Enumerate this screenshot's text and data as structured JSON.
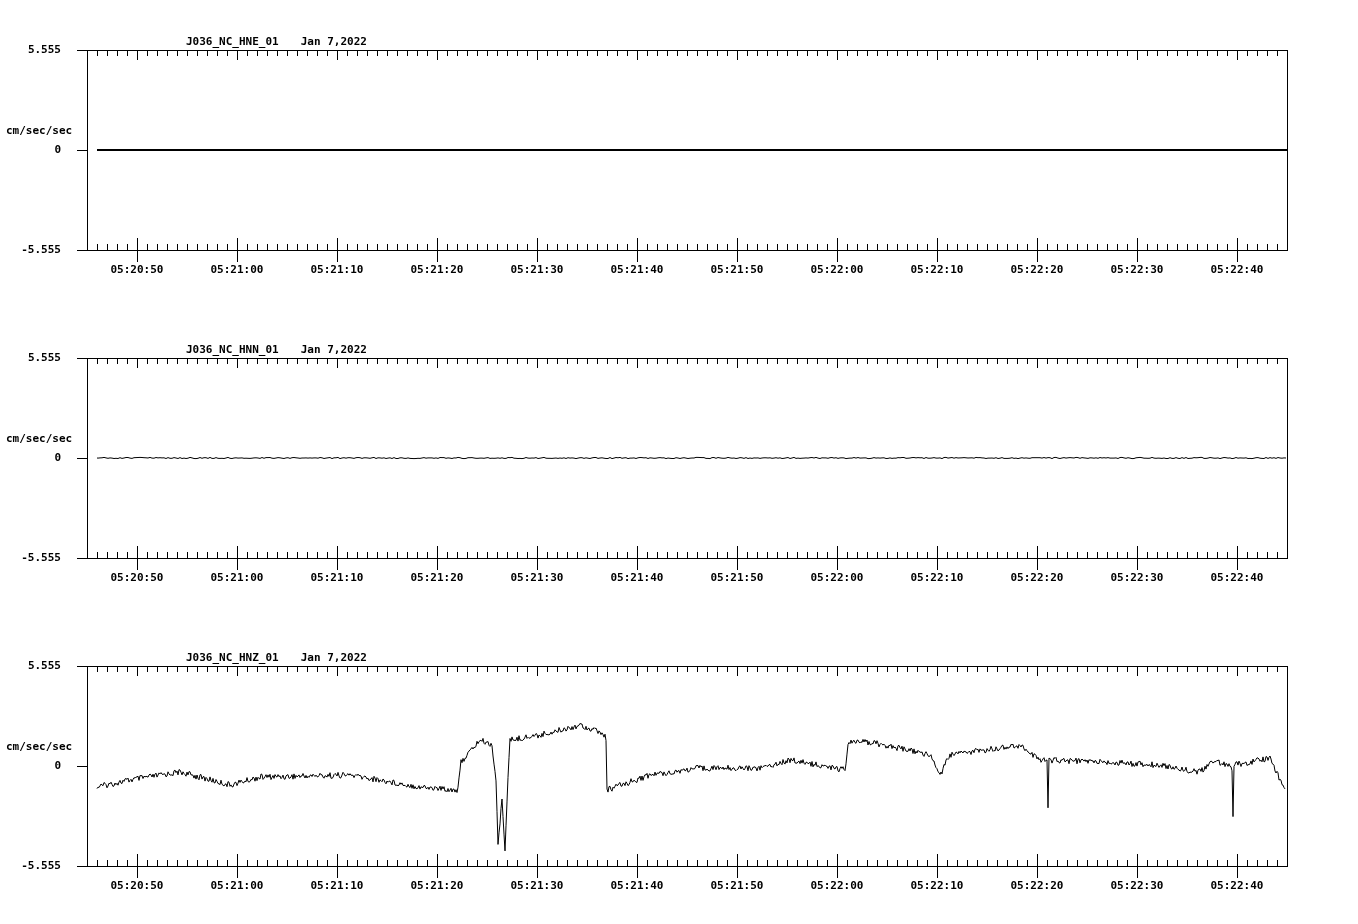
{
  "panels": [
    {
      "station": "J036_NC_HNE_01",
      "date": "Jan 7,2022",
      "ylabel": "cm/sec/sec",
      "yticks": [
        "5.555",
        "0",
        "-5.555"
      ],
      "xticks": [
        "05:20:50",
        "05:21:00",
        "05:21:10",
        "05:21:20",
        "05:21:30",
        "05:21:40",
        "05:21:50",
        "05:22:00",
        "05:22:10",
        "05:22:20",
        "05:22:30",
        "05:22:40"
      ],
      "trace": {
        "kind": "flat"
      }
    },
    {
      "station": "J036_NC_HNN_01",
      "date": "Jan 7,2022",
      "ylabel": "cm/sec/sec",
      "yticks": [
        "5.555",
        "0",
        "-5.555"
      ],
      "xticks": [
        "05:20:50",
        "05:21:00",
        "05:21:10",
        "05:21:20",
        "05:21:30",
        "05:21:40",
        "05:21:50",
        "05:22:00",
        "05:22:10",
        "05:22:20",
        "05:22:30",
        "05:22:40"
      ],
      "trace": {
        "kind": "noisy"
      }
    },
    {
      "station": "J036_NC_HNZ_01",
      "date": "Jan 7,2022",
      "ylabel": "cm/sec/sec",
      "yticks": [
        "5.555",
        "0",
        "-5.555"
      ],
      "xticks": [
        "05:20:50",
        "05:21:00",
        "05:21:10",
        "05:21:20",
        "05:21:30",
        "05:21:40",
        "05:21:50",
        "05:22:00",
        "05:22:10",
        "05:22:20",
        "05:22:30",
        "05:22:40"
      ],
      "trace": {
        "kind": "wave"
      }
    }
  ]
}
